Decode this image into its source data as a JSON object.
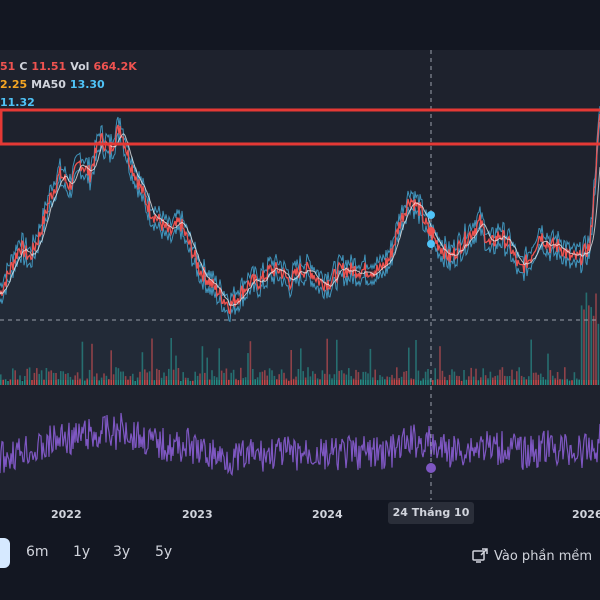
{
  "legend": {
    "line1": {
      "partial": "51",
      "c_label": "C",
      "c_value": "11.51",
      "vol_label": "Vol",
      "vol_value": "664.2K"
    },
    "line2": {
      "partial": "2.25",
      "ma_label": "MA50",
      "ma_value": "13.30"
    },
    "line3": {
      "partial": "11.32"
    }
  },
  "x_axis": {
    "labels": [
      "2022",
      "2023",
      "2024",
      "2026"
    ],
    "crosshair_label": "24 Tháng 10 '24"
  },
  "periods": [
    {
      "label": "6m"
    },
    {
      "label": "1y"
    },
    {
      "label": "3y"
    },
    {
      "label": "5y"
    }
  ],
  "footer": {
    "open_app_label": "Vào phần mềm",
    "icon": "external-screen-icon"
  },
  "colors": {
    "price_up": "#26a69a",
    "price_down": "#ef5350",
    "ma": "#4fc3f7",
    "rsi": "#7e57c2",
    "highlight_box": "#e53935",
    "legend_orange": "#f5a623"
  },
  "chart_data": {
    "type": "line",
    "x_ticks": [
      "2022",
      "2023",
      "2024",
      "2026"
    ],
    "crosshair_x": "24 Tháng 10 '24",
    "price_series": [
      11,
      13,
      15,
      14,
      16,
      19,
      21,
      20,
      22,
      21,
      24,
      23,
      25,
      22,
      20,
      18,
      17,
      16,
      17,
      15,
      13,
      12,
      11,
      10,
      11,
      12,
      12,
      13,
      13,
      12,
      13,
      13,
      12,
      12,
      13,
      13,
      13,
      13,
      13,
      14,
      17,
      19,
      18,
      16,
      15,
      14,
      15,
      16,
      17,
      15,
      16,
      15,
      13,
      14,
      16,
      15,
      15,
      14,
      14,
      15,
      26
    ]
  }
}
